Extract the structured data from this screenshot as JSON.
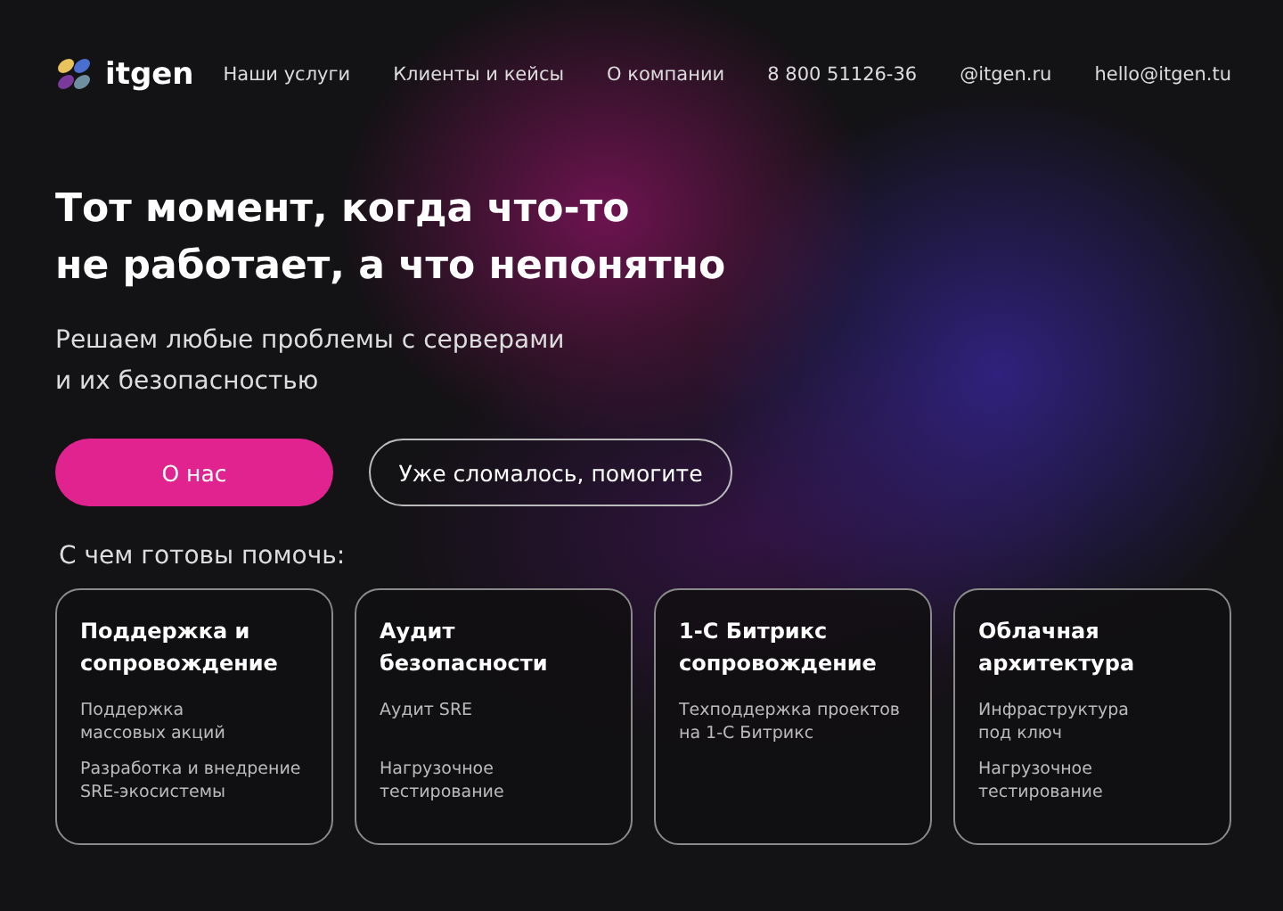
{
  "logo": {
    "text": "itgen"
  },
  "nav": [
    "Наши услуги",
    "Клиенты и кейсы",
    "О компании",
    "8 800 51126-36",
    "@itgen.ru",
    "hello@itgen.tu"
  ],
  "hero": {
    "title": "Тот момент, когда что-то\nне работает, а что непонятно",
    "subtitle": "Решаем любые проблемы с серверами\nи их безопасностью"
  },
  "buttons": [
    {
      "label": "О нас",
      "kind": "primary"
    },
    {
      "label": "Уже сломалось, помогите",
      "kind": "outline"
    }
  ],
  "section_title": "С чем готовы помочь:",
  "cards": [
    {
      "title": "Поддержка и\nсопровождение",
      "items": [
        "Поддержка\nмассовых акций",
        "Разработка и внедрение\nSRE-экосистемы"
      ]
    },
    {
      "title": "Аудит\nбезопасности",
      "items": [
        "Аудит SRE",
        "Нагрузочное\nтестирование"
      ]
    },
    {
      "title": "1-С Битрикс\nсопровождение",
      "items": [
        "Техподдержка проектов\nна 1-С Битрикс"
      ]
    },
    {
      "title": "Облачная\nархитектура",
      "items": [
        "Инфраструктура\nпод ключ",
        "Нагрузочное\nтестирование"
      ]
    }
  ]
}
